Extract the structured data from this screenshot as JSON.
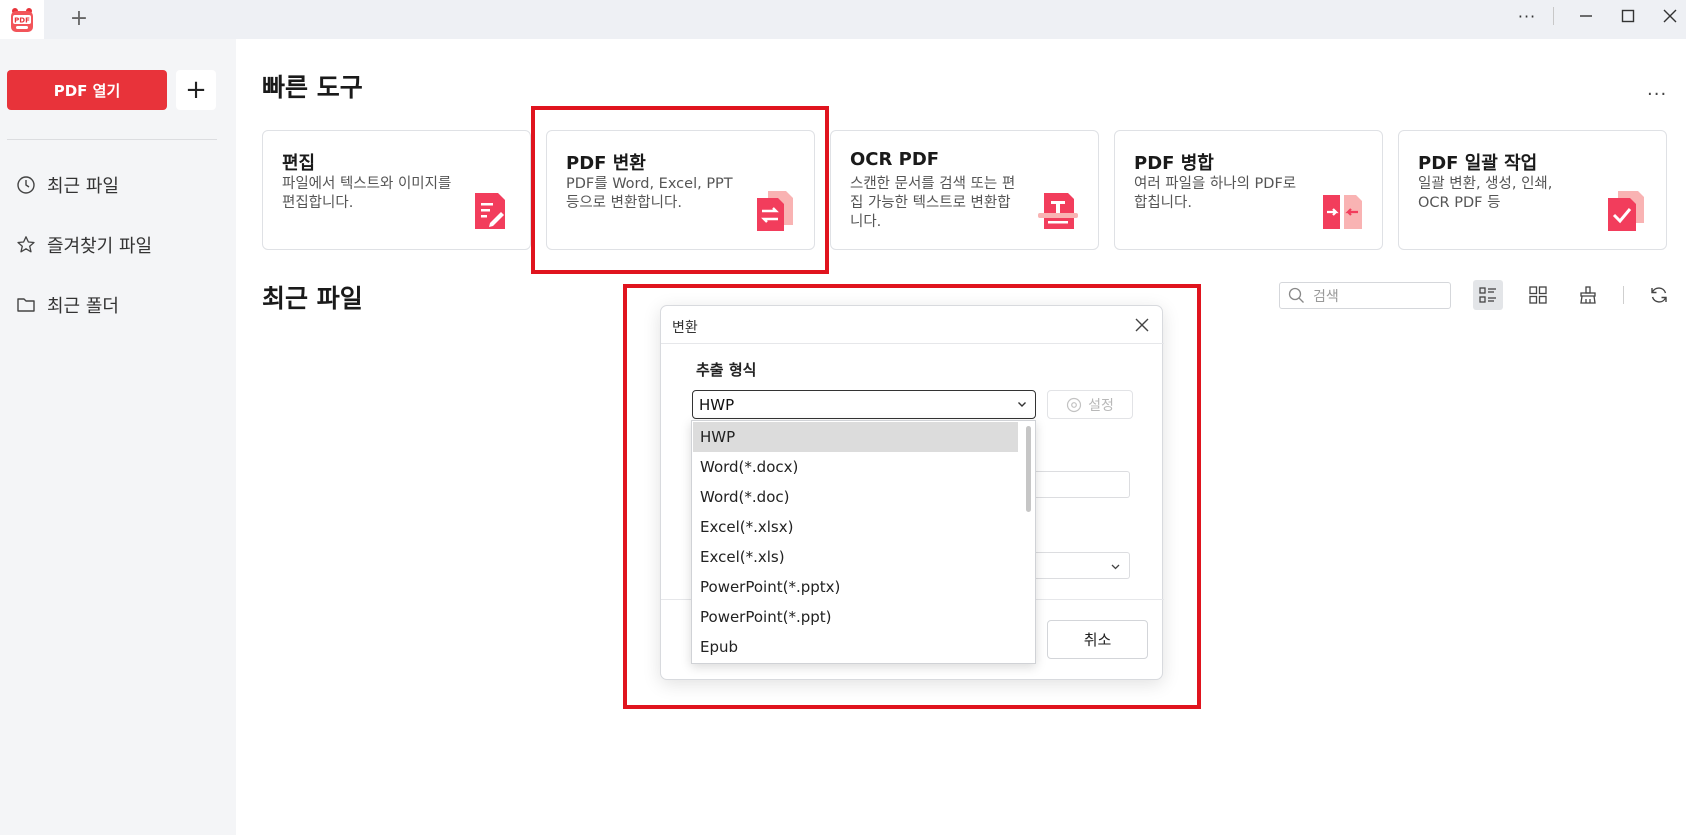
{
  "app": {
    "logo_text": "PDF",
    "colors": {
      "accent": "#e8333a",
      "highlight": "#e0141e"
    }
  },
  "titlebar": {
    "new_tab": "+",
    "more": "···"
  },
  "sidebar": {
    "open_pdf": "PDF 열기",
    "add": "+",
    "items": [
      {
        "label": "최근 파일",
        "icon": "clock-icon"
      },
      {
        "label": "즐겨찾기 파일",
        "icon": "star-icon"
      },
      {
        "label": "최근 폴더",
        "icon": "folder-icon"
      }
    ]
  },
  "quick_tools": {
    "title": "빠른 도구",
    "more": "···",
    "cards": [
      {
        "title": "편집",
        "desc": "파일에서 텍스트와 이미지를 편집합니다.",
        "icon": "edit-icon"
      },
      {
        "title": "PDF 변환",
        "desc": "PDF를 Word, Excel, PPT 등으로 변환합니다.",
        "icon": "convert-icon"
      },
      {
        "title": "OCR PDF",
        "desc": "스캔한 문서를 검색 또는 편집 가능한 텍스트로 변환합니다.",
        "icon": "ocr-icon"
      },
      {
        "title": "PDF 병합",
        "desc": "여러 파일을 하나의 PDF로 합칩니다.",
        "icon": "merge-icon"
      },
      {
        "title": "PDF 일괄 작업",
        "desc": "일괄 변환, 생성, 인쇄, OCR PDF 등",
        "icon": "batch-icon"
      }
    ]
  },
  "recent": {
    "title": "최근 파일",
    "search_placeholder": "검색"
  },
  "dialog": {
    "title": "변환",
    "format_label": "추출 형식",
    "selected_format": "HWP",
    "settings": "설정",
    "cancel": "취소",
    "options": [
      "HWP",
      "Word(*.docx)",
      "Word(*.doc)",
      "Excel(*.xlsx)",
      "Excel(*.xls)",
      "PowerPoint(*.pptx)",
      "PowerPoint(*.ppt)",
      "Epub"
    ]
  }
}
